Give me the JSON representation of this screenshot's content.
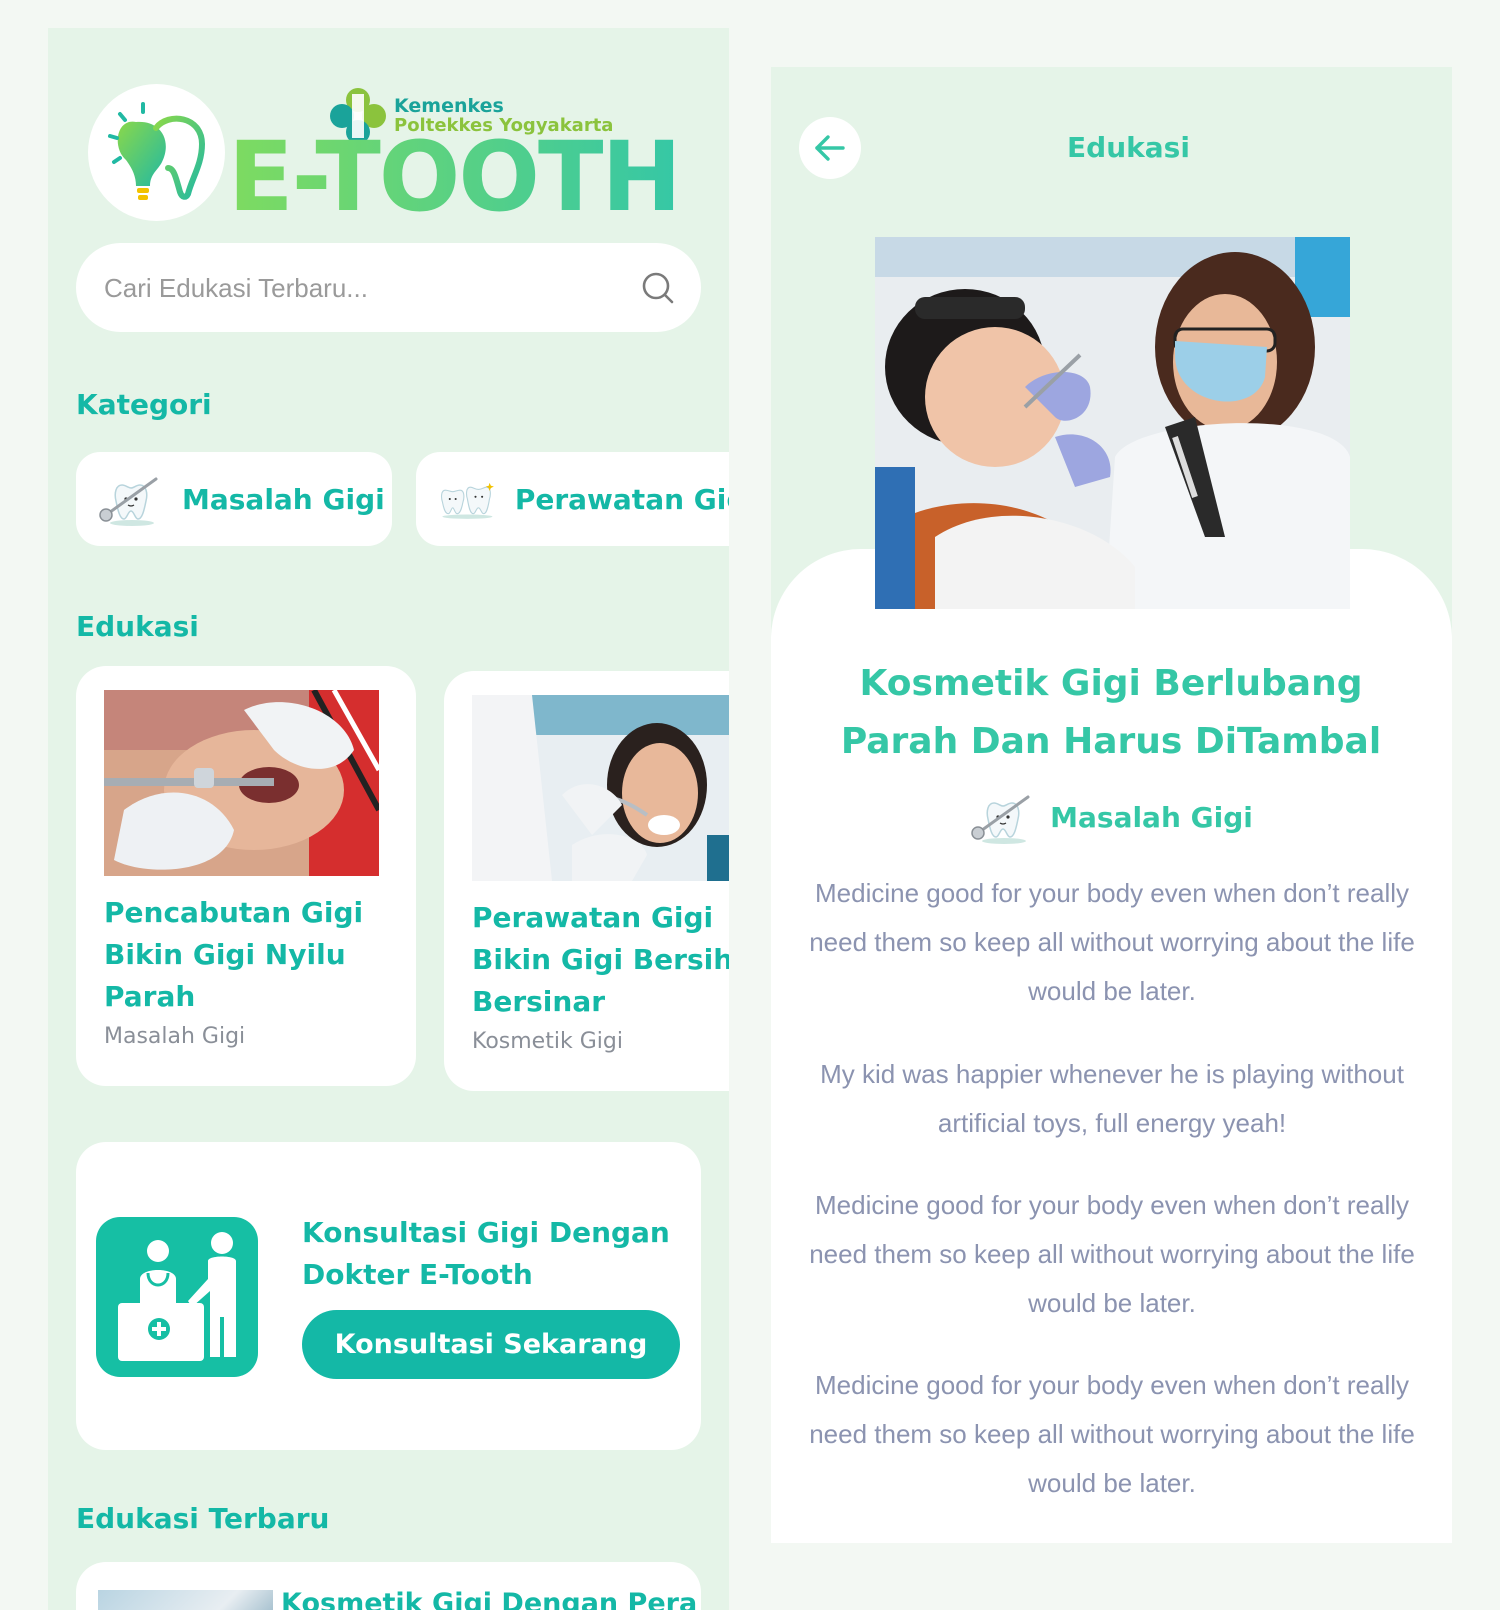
{
  "left": {
    "brand": {
      "org1": "Kemenkes",
      "org2": "Poltekkes Yogyakarta",
      "title": "E-TOOTH"
    },
    "search": {
      "placeholder": "Cari Edukasi Terbaru..."
    },
    "kategori_title": "Kategori",
    "categories": [
      {
        "label": "Masalah Gigi",
        "icon": "tooth-mirror-icon"
      },
      {
        "label": "Perawatan Gigi",
        "icon": "twin-teeth-icon"
      }
    ],
    "edukasi_title": "Edukasi",
    "edu_cards": [
      {
        "title": "Pencabutan Gigi Bikin Gigi Nyilu Parah",
        "category": "Masalah Gigi"
      },
      {
        "title": "Perawatan Gigi Bikin Gigi Bersih Bersinar",
        "category": "Kosmetik Gigi"
      }
    ],
    "consult": {
      "title": "Konsultasi Gigi Dengan Dokter E-Tooth",
      "button": "Konsultasi Sekarang"
    },
    "latest_title": "Edukasi Terbaru",
    "latest_item": {
      "title": "Kosmetik Gigi Dengan Pera"
    }
  },
  "right": {
    "header_title": "Edukasi",
    "article": {
      "title": "Kosmetik Gigi Berlubang Parah Dan Harus DiTambal",
      "category": "Masalah Gigi",
      "paragraphs": [
        "Medicine good for your body even when don’t really need them so keep all without worrying about the life would be later.",
        "My kid was happier whenever he is playing without artificial toys, full energy yeah!",
        "Medicine good for your body even when don’t really need them so keep all without worrying about the life would be later.",
        "Medicine good for your body even when don’t really need them so keep all without worrying about the life would be later."
      ]
    }
  },
  "colors": {
    "accent": "#14b8a6",
    "accent_light": "#35c7a6",
    "bg": "#e5f4e8",
    "body_text": "#8b93b0"
  }
}
